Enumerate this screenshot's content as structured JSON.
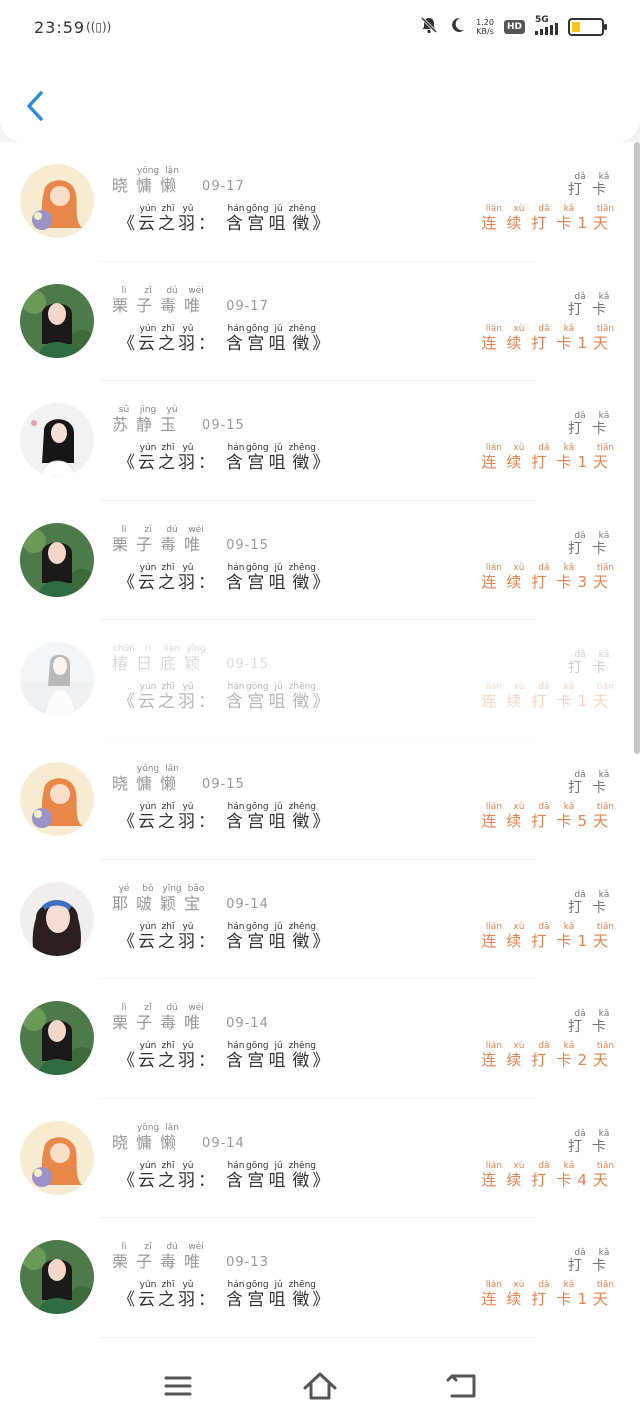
{
  "status": {
    "time": "23:59",
    "vibrate_icon": "vibrate-icon",
    "net_speed_value": "1.20",
    "net_speed_unit": "KB/s",
    "hd": "HD",
    "network": "5G"
  },
  "header": {
    "back_icon": "back-chevron-icon",
    "accent": "#2f8ae0"
  },
  "colors": {
    "streak": "#e8824c",
    "muted": "#999999",
    "title": "#333333"
  },
  "book_title": {
    "open": "《",
    "close": "》",
    "colon": "：",
    "words_a": [
      {
        "char": "云",
        "py": "yún"
      },
      {
        "char": "之",
        "py": "zhī"
      },
      {
        "char": "羽",
        "py": "yǔ"
      }
    ],
    "words_b": [
      {
        "char": "含",
        "py": "hán"
      },
      {
        "char": "宫",
        "py": "gōng"
      },
      {
        "char": "咀",
        "py": "jǔ"
      },
      {
        "char": "徵",
        "py": "zhēng"
      }
    ]
  },
  "punch_label": [
    {
      "char": "打",
      "py": "dǎ"
    },
    {
      "char": "卡",
      "py": "kǎ"
    }
  ],
  "streak_label": {
    "prefix": [
      {
        "char": "连",
        "py": "lián"
      },
      {
        "char": "续",
        "py": "xù"
      },
      {
        "char": "打",
        "py": "dǎ"
      },
      {
        "char": "卡",
        "py": "kǎ"
      }
    ],
    "suffix": {
      "char": "天",
      "py": "tiān"
    }
  },
  "entries": [
    {
      "avatar": "avatar-orange-hair-girl",
      "name": [
        {
          "char": "晓",
          "py": ""
        },
        {
          "char": "慵",
          "py": "yōng"
        },
        {
          "char": "懒",
          "py": "lǎn"
        }
      ],
      "date": "09-17",
      "streak": "1",
      "faded": false
    },
    {
      "avatar": "avatar-woman-green-dress",
      "name": [
        {
          "char": "栗",
          "py": "lì"
        },
        {
          "char": "子",
          "py": "zǐ"
        },
        {
          "char": "毒",
          "py": "dú"
        },
        {
          "char": "唯",
          "py": "wéi"
        }
      ],
      "date": "09-17",
      "streak": "1",
      "faded": false
    },
    {
      "avatar": "avatar-woman-dark-hair",
      "name": [
        {
          "char": "苏",
          "py": "sū"
        },
        {
          "char": "静",
          "py": "jìng"
        },
        {
          "char": "玉",
          "py": "yù"
        }
      ],
      "date": "09-15",
      "streak": "1",
      "faded": false
    },
    {
      "avatar": "avatar-woman-green-dress",
      "name": [
        {
          "char": "栗",
          "py": "lì"
        },
        {
          "char": "子",
          "py": "zǐ"
        },
        {
          "char": "毒",
          "py": "dú"
        },
        {
          "char": "唯",
          "py": "wéi"
        }
      ],
      "date": "09-15",
      "streak": "3",
      "faded": false
    },
    {
      "avatar": "avatar-woman-light",
      "name": [
        {
          "char": "椿",
          "py": "chūn"
        },
        {
          "char": "日",
          "py": "rì"
        },
        {
          "char": "底",
          "py": "liàn"
        },
        {
          "char": "颖",
          "py": "yǐng"
        }
      ],
      "date": "09-15",
      "streak": "1",
      "faded": true
    },
    {
      "avatar": "avatar-orange-hair-girl",
      "name": [
        {
          "char": "晓",
          "py": ""
        },
        {
          "char": "慵",
          "py": "yōng"
        },
        {
          "char": "懒",
          "py": "lǎn"
        }
      ],
      "date": "09-15",
      "streak": "5",
      "faded": false
    },
    {
      "avatar": "avatar-woman-blue-headband",
      "name": [
        {
          "char": "耶",
          "py": "yé"
        },
        {
          "char": "啵",
          "py": "bō"
        },
        {
          "char": "颖",
          "py": "yǐng"
        },
        {
          "char": "宝",
          "py": "bǎo"
        }
      ],
      "date": "09-14",
      "streak": "1",
      "faded": false
    },
    {
      "avatar": "avatar-woman-green-dress",
      "name": [
        {
          "char": "栗",
          "py": "lì"
        },
        {
          "char": "子",
          "py": "zǐ"
        },
        {
          "char": "毒",
          "py": "dú"
        },
        {
          "char": "唯",
          "py": "wéi"
        }
      ],
      "date": "09-14",
      "streak": "2",
      "faded": false
    },
    {
      "avatar": "avatar-orange-hair-girl",
      "name": [
        {
          "char": "晓",
          "py": ""
        },
        {
          "char": "慵",
          "py": "yōng"
        },
        {
          "char": "懒",
          "py": "lǎn"
        }
      ],
      "date": "09-14",
      "streak": "4",
      "faded": false
    },
    {
      "avatar": "avatar-woman-green-dress",
      "name": [
        {
          "char": "栗",
          "py": "lì"
        },
        {
          "char": "子",
          "py": "zǐ"
        },
        {
          "char": "毒",
          "py": "dú"
        },
        {
          "char": "唯",
          "py": "wéi"
        }
      ],
      "date": "09-13",
      "streak": "1",
      "faded": false
    }
  ],
  "nav": {
    "menu_icon": "menu-icon",
    "home_icon": "home-icon",
    "back_icon": "return-icon"
  }
}
